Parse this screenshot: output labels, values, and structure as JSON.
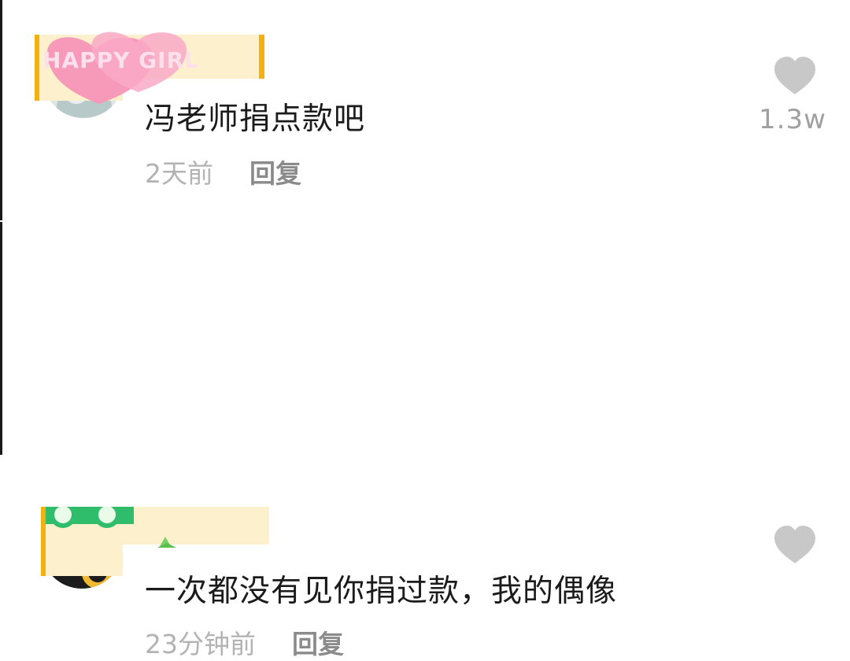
{
  "comments": [
    {
      "avatar": "happy-girl-avatar",
      "sticker_text": "HAPPY GIRL",
      "text": "冯老师捐点款吧",
      "time": "2天前",
      "reply_label": "回复",
      "like_icon": "heart-icon",
      "likes": "1.3w"
    },
    {
      "avatar": "avatar",
      "sticker": "green-glasses",
      "text": "一次都没有见你捐过款，我的偶像",
      "time": "23分钟前",
      "reply_label": "回复",
      "like_icon": "heart-icon",
      "likes": ""
    }
  ],
  "colors": {
    "background": "#ffffff",
    "text": "#1b1b1b",
    "muted_time": "#b3b3b3",
    "reply": "#8b8b8b",
    "heart": "#c8c8c8",
    "like_count": "#a0a0a0",
    "mask_fill": "#fcf1cc",
    "mask_edge": "#f4b10e",
    "sticker_pink": "#f795b7",
    "sticker_green": "#2fbd6c"
  }
}
